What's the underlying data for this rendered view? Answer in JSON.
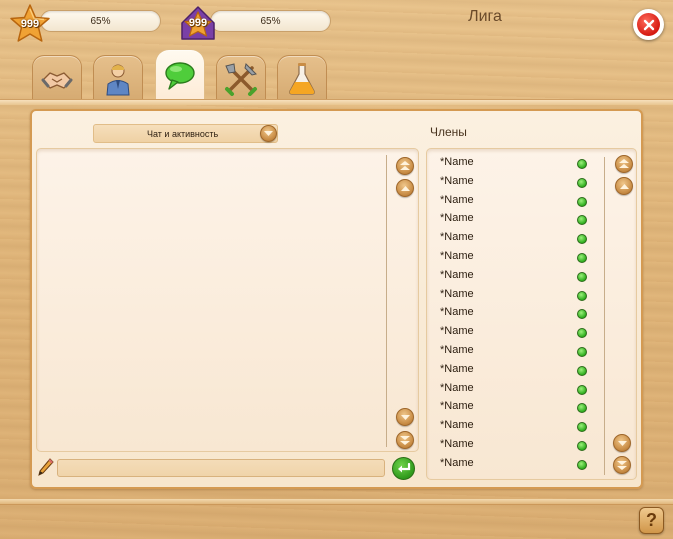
{
  "window": {
    "title": "Лига"
  },
  "stats": [
    {
      "icon": "star-icon",
      "level": "999",
      "progress_label": "65%",
      "progress": 0.65
    },
    {
      "icon": "house-star-icon",
      "level": "999",
      "progress_label": "65%",
      "progress": 0.65
    }
  ],
  "tabs": [
    {
      "icon": "handshake-icon",
      "active": false
    },
    {
      "icon": "person-icon",
      "active": false
    },
    {
      "icon": "chat-bubble-icon",
      "active": true
    },
    {
      "icon": "tools-icon",
      "active": false
    },
    {
      "icon": "flask-icon",
      "active": false
    }
  ],
  "chat": {
    "dropdown_label": "Чат и активность",
    "input_value": ""
  },
  "members": {
    "title": "Члены",
    "items": [
      {
        "name": "*Name",
        "status": "online"
      },
      {
        "name": "*Name",
        "status": "online"
      },
      {
        "name": "*Name",
        "status": "online"
      },
      {
        "name": "*Name",
        "status": "online"
      },
      {
        "name": "*Name",
        "status": "online"
      },
      {
        "name": "*Name",
        "status": "online"
      },
      {
        "name": "*Name",
        "status": "online"
      },
      {
        "name": "*Name",
        "status": "online"
      },
      {
        "name": "*Name",
        "status": "online"
      },
      {
        "name": "*Name",
        "status": "online"
      },
      {
        "name": "*Name",
        "status": "online"
      },
      {
        "name": "*Name",
        "status": "online"
      },
      {
        "name": "*Name",
        "status": "online"
      },
      {
        "name": "*Name",
        "status": "online"
      },
      {
        "name": "*Name",
        "status": "online"
      },
      {
        "name": "*Name",
        "status": "online"
      },
      {
        "name": "*Name",
        "status": "online"
      }
    ]
  },
  "help": {
    "label": "?"
  },
  "colors": {
    "online": "#2fae1e",
    "close": "#d51a12",
    "accent": "#c98d46"
  }
}
